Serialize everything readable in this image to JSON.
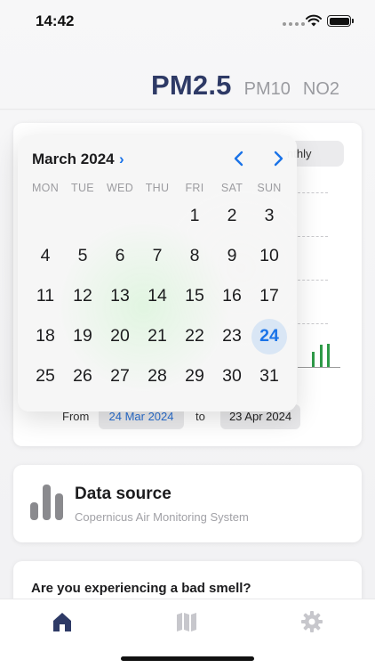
{
  "status_bar": {
    "time": "14:42"
  },
  "pollutant_tabs": {
    "active": "PM2.5",
    "pm10": "PM10",
    "no2": "NO2"
  },
  "chart_card": {
    "period_label": "Monthly",
    "period_visible": "nthly",
    "date_range": {
      "from_label": "From",
      "from_value": "24 Mar 2024",
      "to_label": "to",
      "to_value": "23 Apr 2024"
    },
    "accent_color": "#2e9a48"
  },
  "calendar": {
    "month_title": "March 2024",
    "title_chevron": "›",
    "weekdays": [
      "MON",
      "TUE",
      "WED",
      "THU",
      "FRI",
      "SAT",
      "SUN"
    ],
    "leading_blanks": 4,
    "days_in_month": 31,
    "selected_day": 24,
    "accent_color": "#1a73e8"
  },
  "data_source": {
    "title": "Data source",
    "subtitle": "Copernicus Air Monitoring System",
    "icon": "bar-chart-icon"
  },
  "smell_prompt": {
    "question": "Are you experiencing a bad smell?"
  },
  "tab_bar": {
    "items": [
      {
        "name": "home",
        "icon": "home-icon",
        "active": true
      },
      {
        "name": "map",
        "icon": "map-icon",
        "active": false
      },
      {
        "name": "settings",
        "icon": "gear-icon",
        "active": false
      }
    ],
    "active_color": "#2e3a66",
    "inactive_color": "#c7c7cc"
  }
}
